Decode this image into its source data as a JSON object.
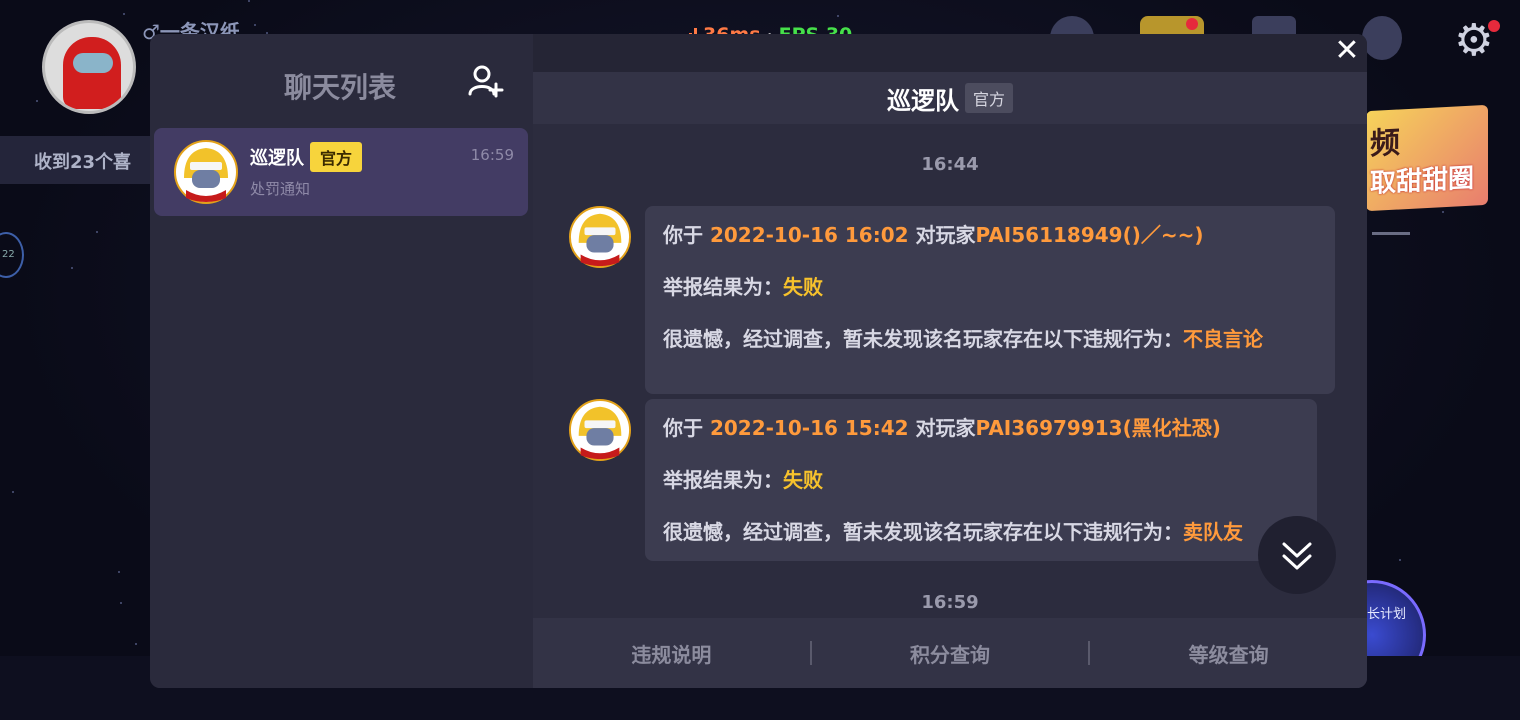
{
  "background": {
    "username": "♂一条汉纸",
    "received_text": "收到23个喜",
    "level_badge": "22",
    "banner_line1": "频",
    "banner_line2": "取甜甜圈",
    "badge_text": "长计划"
  },
  "net_status": {
    "ping": "36ms",
    "separator": "·",
    "fps": "FPS 30",
    "ping_color": "#ff7a45",
    "fps_color": "#46e04a"
  },
  "chat_list": {
    "title": "聊天列表",
    "add_friend_icon": "add-user-icon",
    "items": [
      {
        "name": "巡逻队",
        "badge": "官方",
        "time": "16:59",
        "preview": "处罚通知"
      }
    ]
  },
  "conversation": {
    "header_name": "巡逻队",
    "header_badge": "官方",
    "close_icon": "close-icon",
    "timestamps": [
      "16:44",
      "16:59"
    ],
    "messages": [
      {
        "line1_prefix": "你于",
        "line1_date": "2022-10-16 16:02",
        "line1_mid": "对玩家",
        "line1_player": "PAI56118949()／~~)",
        "line2_label": "举报结果为：",
        "line2_result": "失败",
        "line3_text": "很遗憾，经过调查，暂未发现该名玩家存在以下违规行为：",
        "line3_violation": "不良言论"
      },
      {
        "line1_prefix": "你于",
        "line1_date": "2022-10-16 15:42",
        "line1_mid": "对玩家",
        "line1_player": "PAI36979913(黑化社恐)",
        "line2_label": "举报结果为：",
        "line2_result": "失败",
        "line3_text": "很遗憾，经过调查，暂未发现该名玩家存在以下违规行为：",
        "line3_violation": "卖队友"
      }
    ],
    "footer": [
      "违规说明",
      "积分查询",
      "等级查询"
    ]
  },
  "colors": {
    "accent_orange": "#ff9a3c",
    "result_yellow": "#f7c22c",
    "official_badge_yellow": "#f7d43c",
    "selected_item": "#433c64"
  }
}
